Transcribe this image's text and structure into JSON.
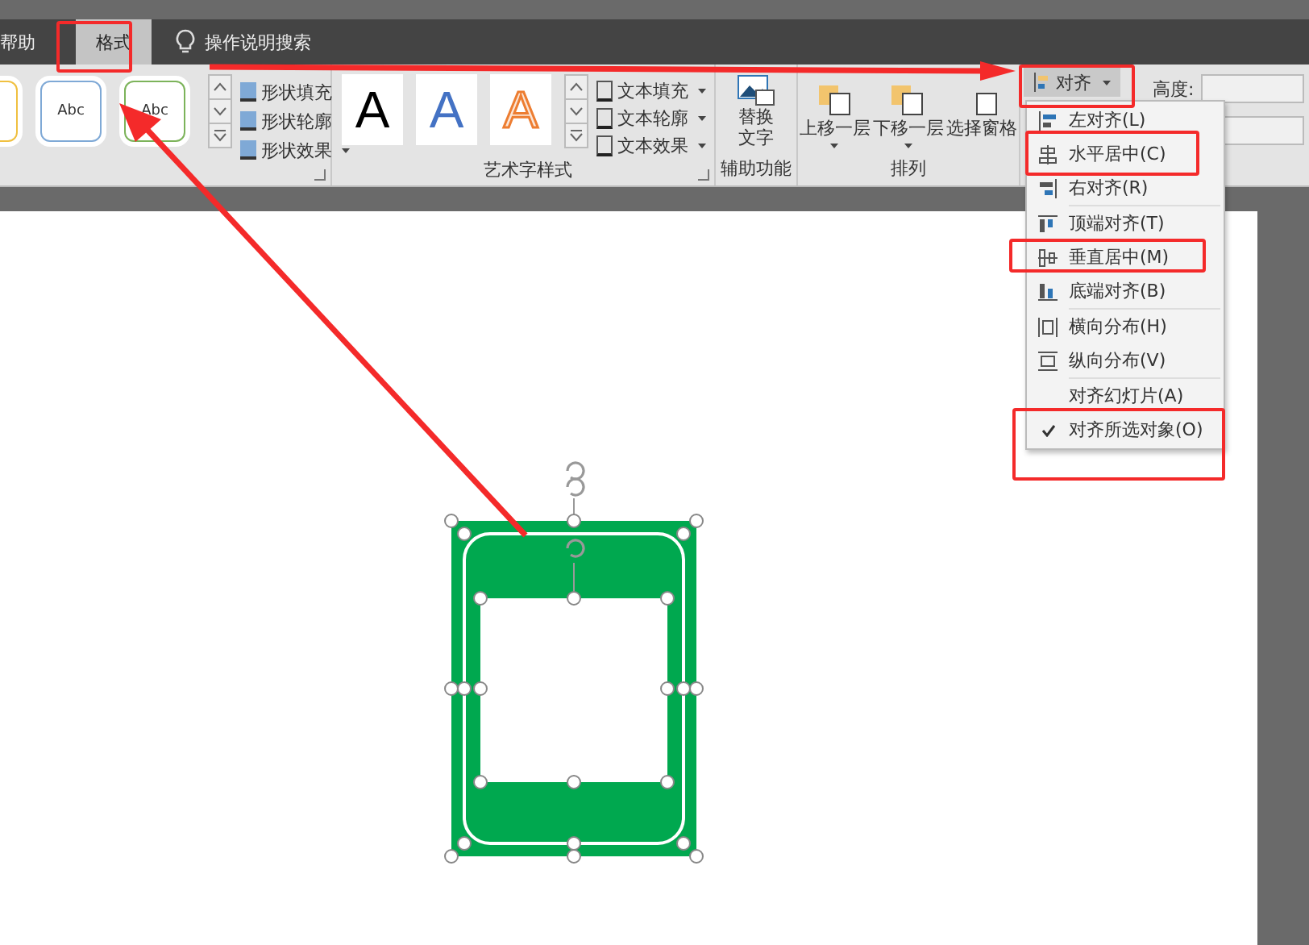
{
  "tabs": [
    {
      "label": "帮助",
      "selected": false
    },
    {
      "label": "格式",
      "selected": true
    }
  ],
  "tell_me": {
    "placeholder": "操作说明搜索"
  },
  "ribbon": {
    "shape_commands": [
      "形状填充",
      "形状轮廓",
      "形状效果"
    ],
    "shape_styles": [
      "Abc",
      "Abc"
    ],
    "wordart_styles": [
      "A",
      "A",
      "A"
    ],
    "text_commands": [
      "文本填充",
      "文本轮廓",
      "文本效果"
    ],
    "wordart_label": "艺术字样式",
    "alt_text": {
      "line1": "替换",
      "line2": "文字"
    },
    "accessibility_label": "辅助功能",
    "arrange_buttons": [
      "上移一层",
      "下移一层",
      "选择窗格"
    ],
    "arrange_label": "排列",
    "align_button": "对齐",
    "height_label": "高度:"
  },
  "align_menu": [
    {
      "kind": "left",
      "label": "左对齐(L)",
      "checked": false,
      "separator_after": false
    },
    {
      "kind": "hcenter",
      "label": "水平居中(C)",
      "checked": false,
      "separator_after": false
    },
    {
      "kind": "right",
      "label": "右对齐(R)",
      "checked": false,
      "separator_after": true
    },
    {
      "kind": "top",
      "label": "顶端对齐(T)",
      "checked": false,
      "separator_after": false
    },
    {
      "kind": "vcenter",
      "label": "垂直居中(M)",
      "checked": false,
      "separator_after": false
    },
    {
      "kind": "bottom",
      "label": "底端对齐(B)",
      "checked": false,
      "separator_after": true
    },
    {
      "kind": "hdist",
      "label": "横向分布(H)",
      "checked": false,
      "separator_after": false
    },
    {
      "kind": "vdist",
      "label": "纵向分布(V)",
      "checked": false,
      "separator_after": true
    },
    {
      "kind": "none",
      "label": "对齐幻灯片(A)",
      "checked": false,
      "separator_after": false
    },
    {
      "kind": "none",
      "label": "对齐所选对象(O)",
      "checked": true,
      "separator_after": false
    }
  ]
}
